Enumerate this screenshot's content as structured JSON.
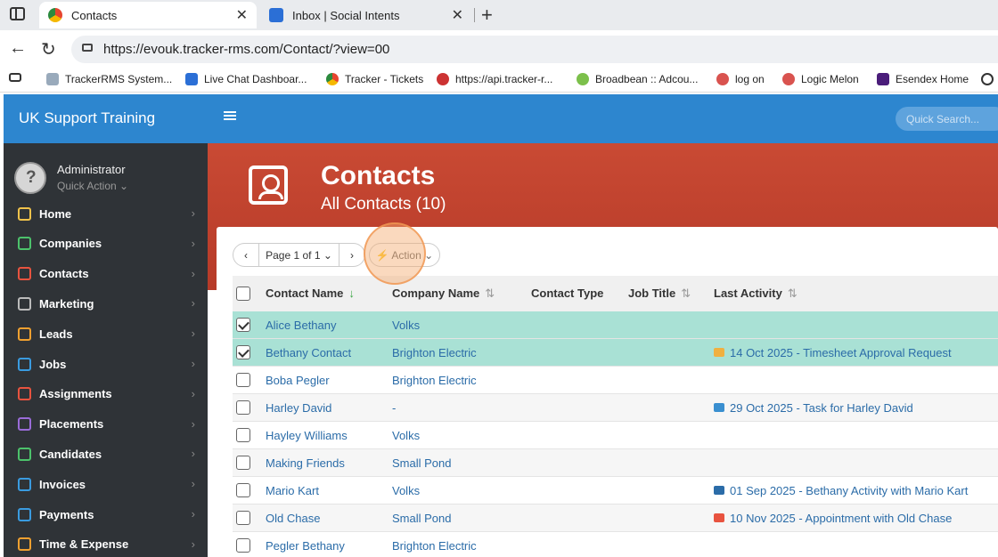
{
  "browser": {
    "tabs": [
      {
        "title": "Contacts",
        "close": "✕"
      },
      {
        "title": "Inbox | Social Intents",
        "close": "✕"
      }
    ],
    "new_tab": "+",
    "url": "https://evouk.tracker-rms.com/Contact/?view=00",
    "bookmarks": [
      {
        "label": "TrackerRMS System...",
        "color": "#8aa"
      },
      {
        "label": "Live Chat Dashboar...",
        "color": "#2b6fd6"
      },
      {
        "label": "Tracker - Tickets",
        "color": "#e6452f"
      },
      {
        "label": "https://api.tracker-r...",
        "color": "#c33"
      },
      {
        "label": "Broadbean :: Adcou...",
        "color": "#7cc04b"
      },
      {
        "label": "log on",
        "color": "#d9534f"
      },
      {
        "label": "Logic Melon",
        "color": "#d9534f"
      },
      {
        "label": "Esendex Home",
        "color": "#4a1d7a"
      }
    ]
  },
  "app": {
    "brand": "UK Support Training",
    "quick_search": "Quick Search...",
    "user": {
      "name": "Administrator",
      "quick_action": "Quick Action ⌄"
    },
    "menu": [
      {
        "label": "Home",
        "color": "#f0c24b"
      },
      {
        "label": "Companies",
        "color": "#4cc26b"
      },
      {
        "label": "Contacts",
        "color": "#e8533f"
      },
      {
        "label": "Marketing",
        "color": "#bbb"
      },
      {
        "label": "Leads",
        "color": "#f0a030"
      },
      {
        "label": "Jobs",
        "color": "#3a9be0"
      },
      {
        "label": "Assignments",
        "color": "#e8533f"
      },
      {
        "label": "Placements",
        "color": "#9a6cd8"
      },
      {
        "label": "Candidates",
        "color": "#4cc26b"
      },
      {
        "label": "Invoices",
        "color": "#3a9be0"
      },
      {
        "label": "Payments",
        "color": "#3a9be0"
      },
      {
        "label": "Time & Expense",
        "color": "#f0a030"
      }
    ],
    "menu_chevron": "›",
    "page": {
      "title": "Contacts",
      "subtitle": "All Contacts (10)"
    },
    "pager": {
      "prev": "‹",
      "page": "Page 1 of 1 ⌄",
      "next": "›",
      "action": "⚡ Action ⌄"
    },
    "columns": {
      "contact_name": "Contact Name",
      "company_name": "Company Name",
      "contact_type": "Contact Type",
      "job_title": "Job Title",
      "last_activity": "Last Activity",
      "sort_asc": "↓",
      "sort_both": "⇅"
    },
    "rows": [
      {
        "name": "Alice Bethany",
        "company": "Volks",
        "activity": "",
        "act_color": "",
        "checked": true
      },
      {
        "name": "Bethany Contact",
        "company": "Brighton Electric",
        "activity": "14 Oct 2025 - Timesheet Approval Request",
        "act_color": "#f0b040",
        "checked": true
      },
      {
        "name": "Boba Pegler",
        "company": "Brighton Electric",
        "activity": "",
        "act_color": "",
        "checked": false
      },
      {
        "name": "Harley David",
        "company": "-",
        "activity": "29 Oct 2025 - Task for Harley David",
        "act_color": "#3a8fd0",
        "checked": false
      },
      {
        "name": "Hayley Williams",
        "company": "Volks",
        "activity": "",
        "act_color": "",
        "checked": false
      },
      {
        "name": "Making Friends",
        "company": "Small Pond",
        "activity": "",
        "act_color": "",
        "checked": false
      },
      {
        "name": "Mario Kart",
        "company": "Volks",
        "activity": "01 Sep 2025 - Bethany Activity with Mario Kart",
        "act_color": "#2b6ca8",
        "checked": false
      },
      {
        "name": "Old Chase",
        "company": "Small Pond",
        "activity": "10 Nov 2025 - Appointment with Old Chase",
        "act_color": "#e8533f",
        "checked": false
      },
      {
        "name": "Pegler Bethany",
        "company": "Brighton Electric",
        "activity": "",
        "act_color": "",
        "checked": false
      }
    ]
  }
}
